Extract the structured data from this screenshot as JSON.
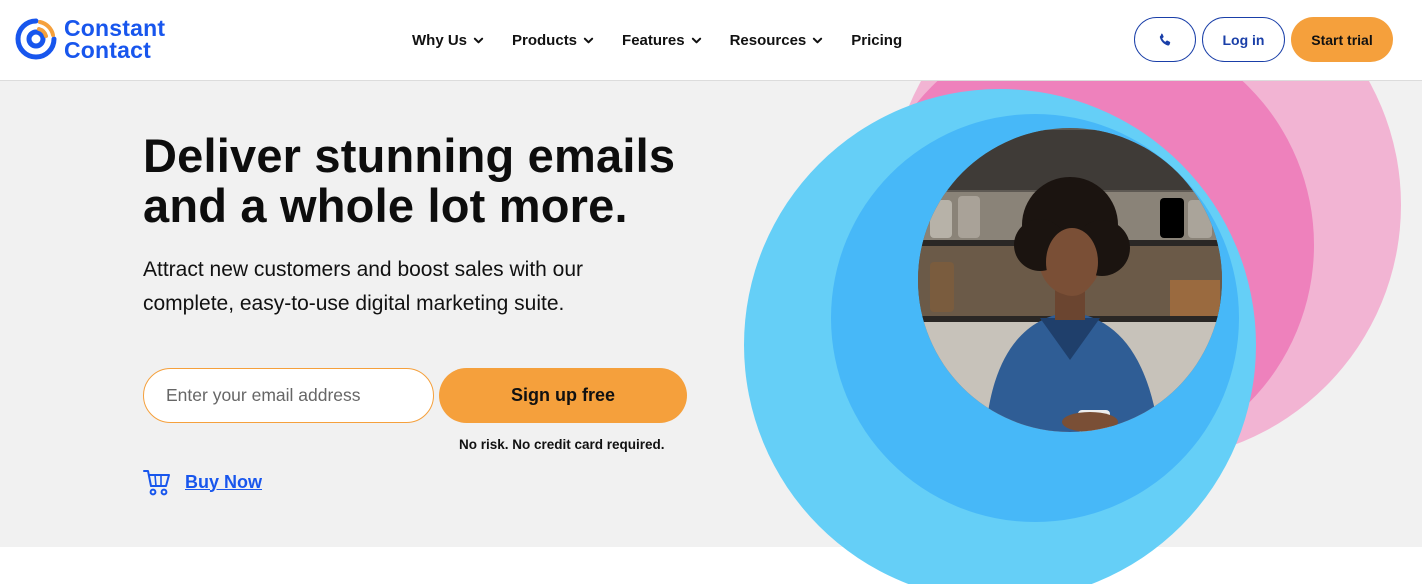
{
  "brand": {
    "name_line1": "Constant",
    "name_line2": "Contact",
    "logo_icon": "constant-contact-logo-icon",
    "color": "#1856ed"
  },
  "nav": {
    "items": [
      {
        "label": "Why Us",
        "has_dropdown": true
      },
      {
        "label": "Products",
        "has_dropdown": true
      },
      {
        "label": "Features",
        "has_dropdown": true
      },
      {
        "label": "Resources",
        "has_dropdown": true
      },
      {
        "label": "Pricing",
        "has_dropdown": false
      }
    ]
  },
  "header_actions": {
    "phone_icon": "phone-icon",
    "login_label": "Log in",
    "trial_label": "Start trial"
  },
  "hero": {
    "headline_line1": "Deliver stunning emails",
    "headline_line2": "and a whole lot more.",
    "subhead_line1": "Attract new customers and boost sales with our",
    "subhead_line2": "complete, easy-to-use digital marketing suite.",
    "email_placeholder": "Enter your email address",
    "signup_label": "Sign up free",
    "no_risk_text": "No risk. No credit card required.",
    "buy_now_label": "Buy Now",
    "cart_icon": "shopping-cart-icon"
  },
  "colors": {
    "accent_orange": "#f5a03c",
    "link_blue": "#1856ed",
    "outline_blue": "#1a3fa8",
    "circle_light_blue": "#65cff7",
    "circle_blue": "#47b8f8",
    "circle_light_pink": "#f2b4d3",
    "circle_pink": "#ee81bc",
    "hero_bg": "#f1f1f1"
  }
}
